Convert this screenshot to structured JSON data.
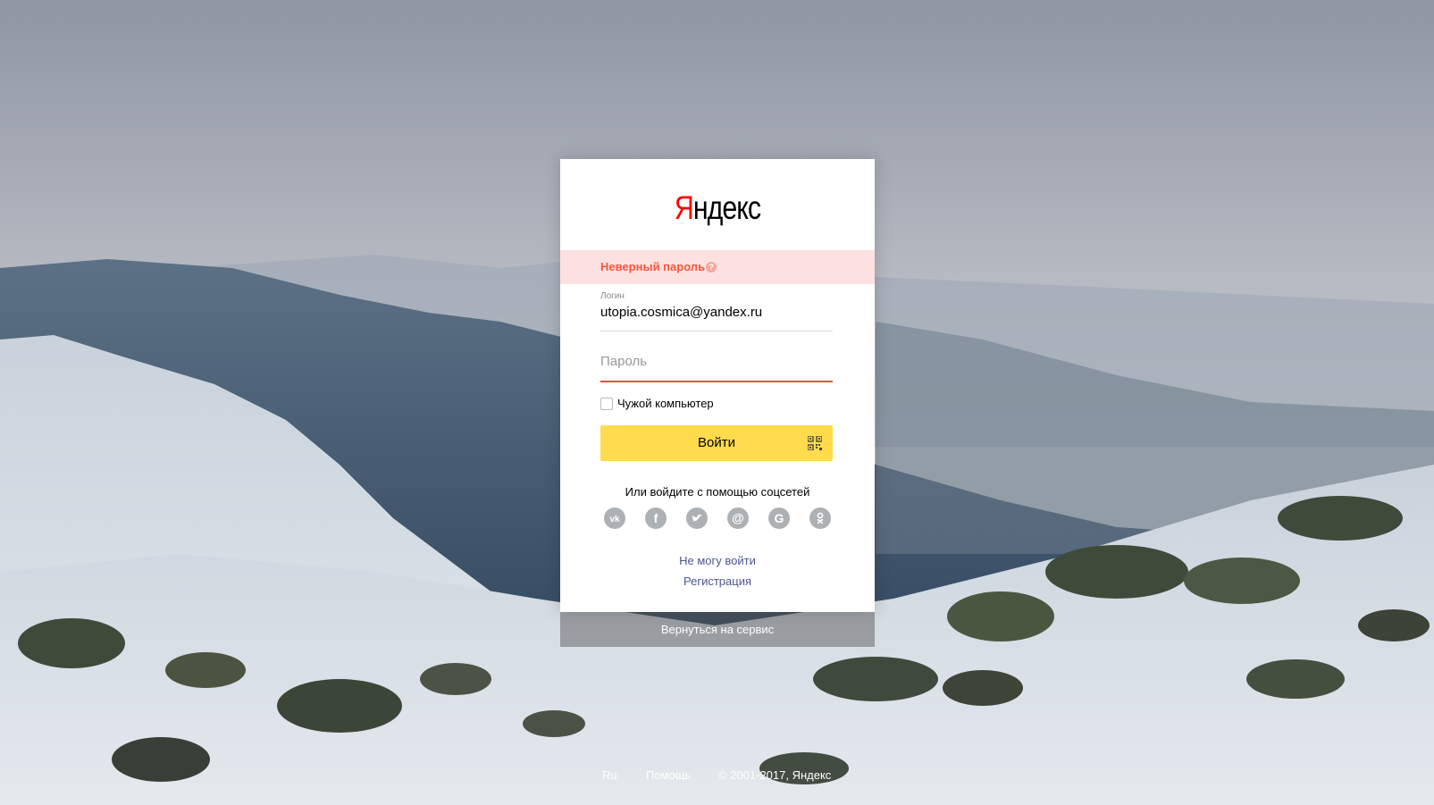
{
  "brand": {
    "logo_first": "Я",
    "logo_rest": "ндекс"
  },
  "error": {
    "message": "Неверный пароль",
    "help_symbol": "?"
  },
  "login": {
    "label": "Логин",
    "value": "utopia.cosmica@yandex.ru"
  },
  "password": {
    "placeholder": "Пароль"
  },
  "foreign_computer": {
    "label": "Чужой компьютер",
    "checked": false
  },
  "submit": {
    "label": "Войти"
  },
  "social": {
    "caption": "Или войдите с помощью соцсетей",
    "providers": [
      "vk-icon",
      "facebook-icon",
      "twitter-icon",
      "mail-icon",
      "google-icon",
      "odnoklassniki-icon"
    ]
  },
  "links": {
    "cant_login": "Не могу войти",
    "register": "Регистрация"
  },
  "back_to_service": "Вернуться на сервис",
  "footer": {
    "lang": "Ru",
    "help": "Помощь",
    "copyright": "© 2001-2017, Яндекс"
  },
  "colors": {
    "accent_yellow": "#ffdb4d",
    "error_red": "#f5573d",
    "error_bg": "#fde1e1",
    "link": "#4e5591"
  }
}
